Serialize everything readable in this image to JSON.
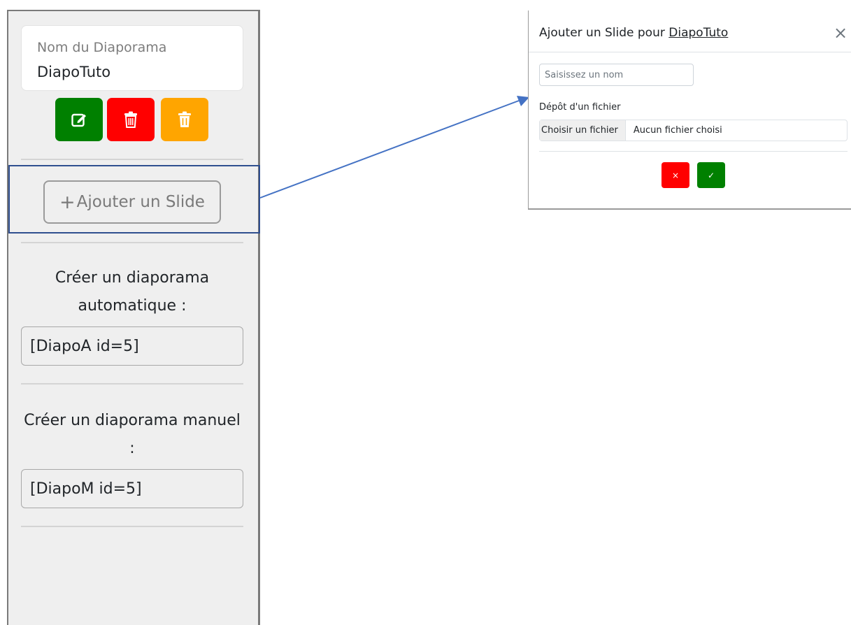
{
  "sidebar": {
    "name_label": "Nom du Diaporama",
    "name_value": "DiapoTuto",
    "actions": {
      "edit_icon": "edit-icon",
      "delete_icon": "trash-icon",
      "clear_icon": "trash-can-icon",
      "edit_color": "#008000",
      "delete_color": "#ff0000",
      "clear_color": "#ffa500"
    },
    "add_slide_plus": "+",
    "add_slide_label": "Ajouter un Slide",
    "auto_title": "Créer un diaporama automatique :",
    "auto_code": "[DiapoA id=5]",
    "manual_title": "Créer un diaporama manuel :",
    "manual_code": "[DiapoM id=5]"
  },
  "modal": {
    "title_prefix": "Ajouter un Slide pour",
    "title_link": "DiapoTuto",
    "close_icon": "×",
    "name_placeholder": "Saisissez un nom",
    "file_label": "Dépôt d'un fichier",
    "file_button": "Choisir un fichier",
    "file_status": "Aucun fichier choisi",
    "cancel_icon": "×",
    "confirm_icon": "✓"
  },
  "annotation": {
    "highlight_color": "#2f4f8f",
    "arrow_color": "#4472c4"
  }
}
